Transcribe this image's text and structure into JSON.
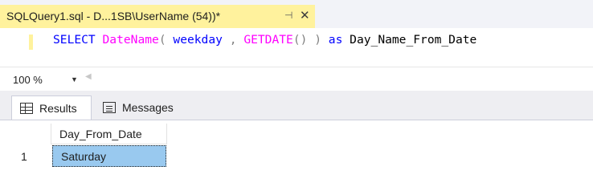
{
  "tab": {
    "title": "SQLQuery1.sql - D...1SB\\UserName (54))*",
    "pin_glyph": "⊣",
    "close_glyph": "✕"
  },
  "editor": {
    "tokens": {
      "select": "SELECT",
      "datename": "DateName",
      "open_paren": "(",
      "weekday": "weekday",
      "comma": ",",
      "getdate": "GETDATE",
      "empty_parens": "()",
      "close_paren": ")",
      "as": "as",
      "alias": "Day_Name_From_Date"
    }
  },
  "zoom": {
    "value": "100 %",
    "arrow": "▼",
    "scroll_left": "◀"
  },
  "results_tabs": {
    "results_label": "Results",
    "messages_label": "Messages"
  },
  "grid": {
    "columns": [
      "Day_From_Date"
    ],
    "rows": [
      {
        "row_number": "1",
        "values": [
          "Saturday"
        ]
      }
    ]
  },
  "colors": {
    "tab_active_bg": "#fff29d",
    "keyword": "#0000ff",
    "function": "#ff00ff",
    "operator": "#808080",
    "selected_cell": "#99c9ef"
  }
}
